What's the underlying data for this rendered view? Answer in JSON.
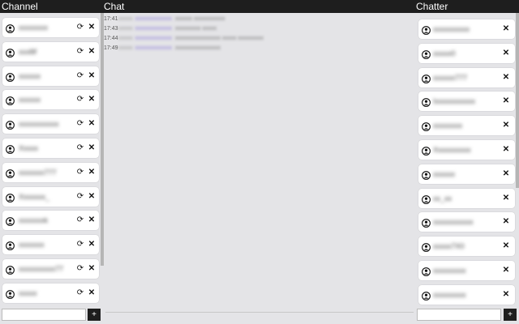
{
  "header": {
    "channel": "Channel",
    "chat": "Chat",
    "chatter": "Chatter"
  },
  "icons": {
    "refresh": "⟳",
    "close": "✕",
    "add": "+"
  },
  "channels": [
    {
      "name": "xxxxxxxx"
    },
    {
      "name": "xxxllif"
    },
    {
      "name": "xxxxxx"
    },
    {
      "name": "xxxxxx"
    },
    {
      "name": "xxxxxxxxxxx"
    },
    {
      "name": "Xxxxx"
    },
    {
      "name": "xxxxxxx777"
    },
    {
      "name": "Xxxxxxx_"
    },
    {
      "name": "xxxxxxxk"
    },
    {
      "name": "xxxxxxx"
    },
    {
      "name": "xxxxxxxxxx77"
    },
    {
      "name": "xxxxx"
    }
  ],
  "chatters": [
    {
      "name": "xxxxxxxxxx"
    },
    {
      "name": "xxxxx0"
    },
    {
      "name": "xxxxxx777"
    },
    {
      "name": "Ixxxxxxxxxxx"
    },
    {
      "name": "xxxxxxxx"
    },
    {
      "name": "Xxxxxxxxxx"
    },
    {
      "name": "xxxxxx"
    },
    {
      "name": "xx_xx"
    },
    {
      "name": "xxxxxxxxxxx"
    },
    {
      "name": "xxxxx7X0"
    },
    {
      "name": "xxxxxxxxx"
    },
    {
      "name": "xxxxxxxxx"
    }
  ],
  "messages": [
    {
      "time": "17:41",
      "badge": "xxxxx",
      "user": "xxxxxxxxxxxxx",
      "text": "xxxxxx xxxxxxxxxxx"
    },
    {
      "time": "17:43",
      "badge": "xxxxx",
      "user": "xxxxxxxxxxxxx",
      "text": "xxxxxxxxx xxxxx"
    },
    {
      "time": "17:44",
      "badge": "xxxxx",
      "user": "xxxxxxxxxxxxx",
      "text": "xxxxxxxxxxxxxxxx xxxxx xxxxxxxxx"
    },
    {
      "time": "17:49",
      "badge": "xxxxx",
      "user": "xxxxxxxxxxxxx",
      "text": "xxxxxxxxxxxxxxxx"
    }
  ]
}
